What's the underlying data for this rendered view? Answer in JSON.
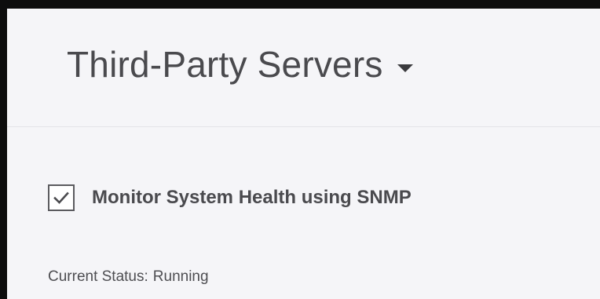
{
  "header": {
    "title": "Third-Party Servers",
    "dropdown_icon": "caret-down-icon"
  },
  "snmp": {
    "checkbox_checked": true,
    "checkbox_icon": "check-icon",
    "label": "Monitor System Health using SNMP"
  },
  "status": {
    "label": "Current Status:",
    "value": "Running"
  }
}
